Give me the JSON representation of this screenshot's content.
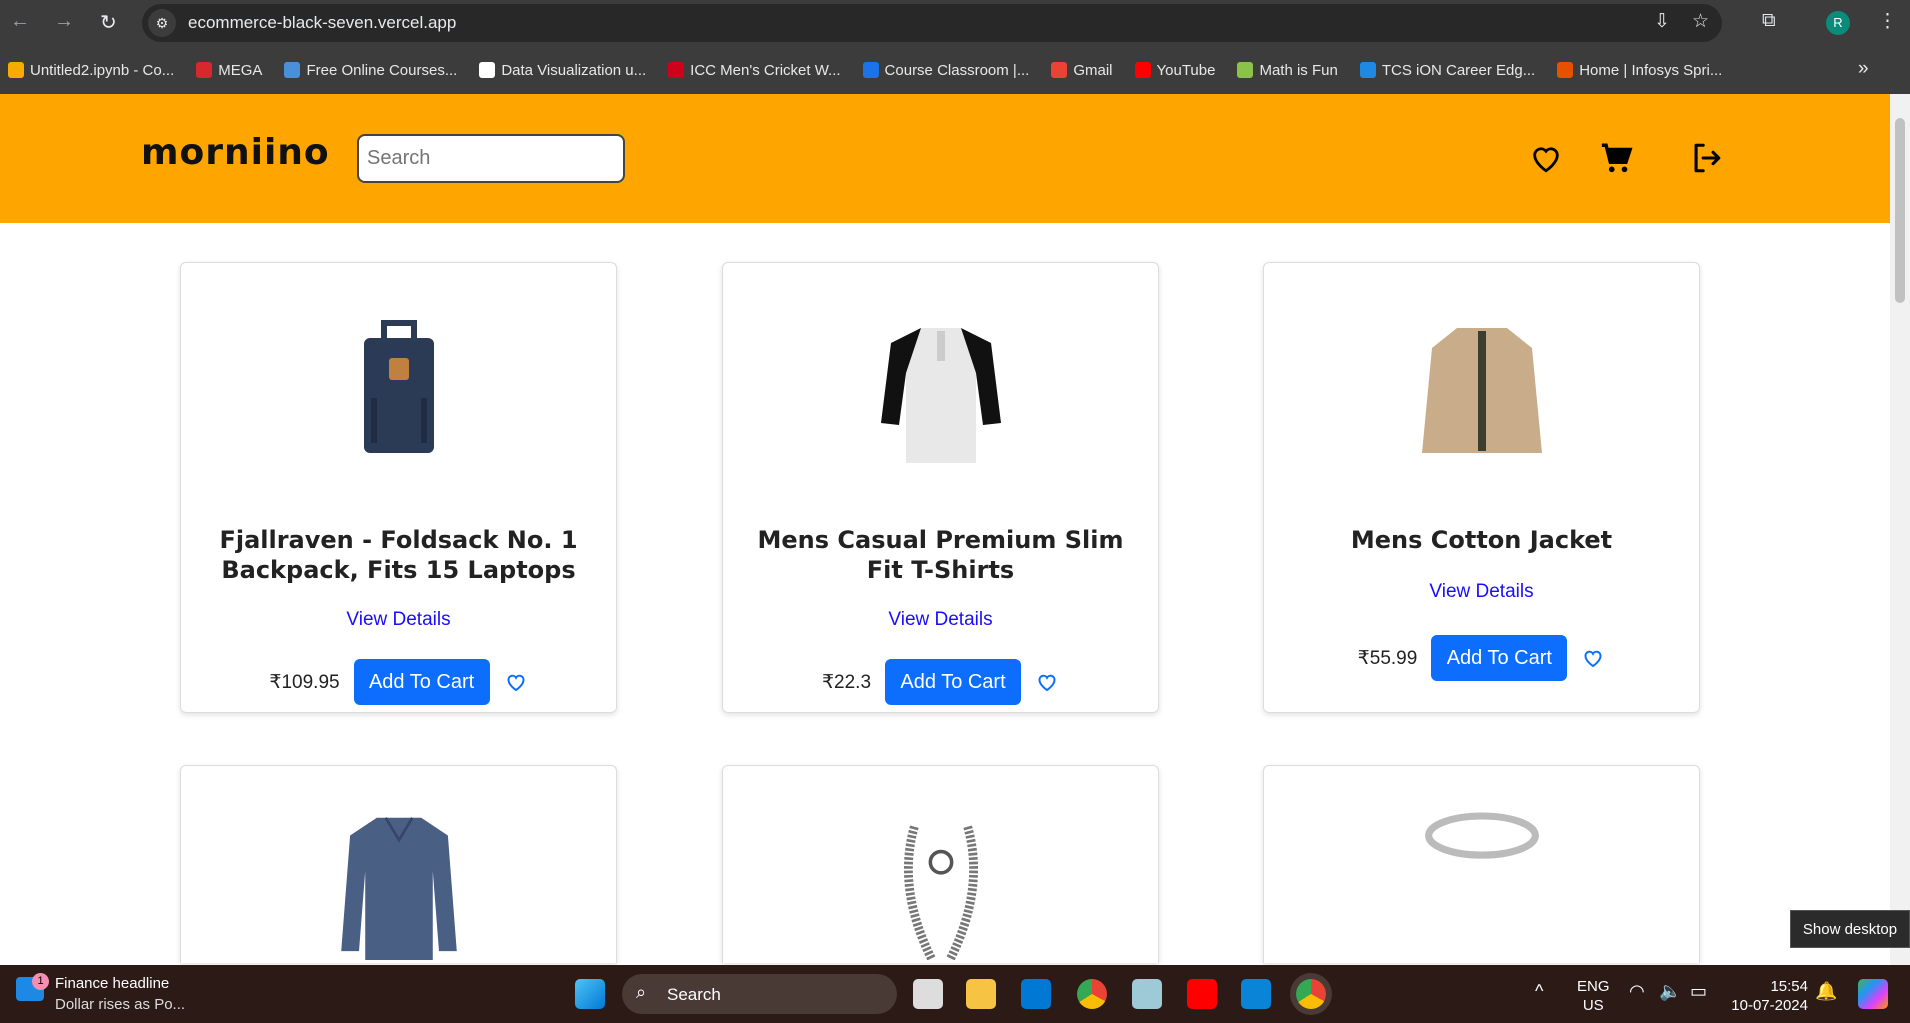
{
  "browser": {
    "url": "ecommerce-black-seven.vercel.app",
    "profile_initial": "R",
    "bookmarks": [
      {
        "label": "Untitled2.ipynb - Co...",
        "color": "#f9ab00"
      },
      {
        "label": "MEGA",
        "color": "#d9272e"
      },
      {
        "label": "Free Online Courses...",
        "color": "#4a90d9"
      },
      {
        "label": "Data Visualization u...",
        "color": "#ffffff"
      },
      {
        "label": "ICC Men's Cricket W...",
        "color": "#d0021b"
      },
      {
        "label": "Course Classroom |...",
        "color": "#1a73e8"
      },
      {
        "label": "Gmail",
        "color": "#ea4335"
      },
      {
        "label": "YouTube",
        "color": "#ff0000"
      },
      {
        "label": "Math is Fun",
        "color": "#8bc34a"
      },
      {
        "label": "TCS iON Career Edg...",
        "color": "#1e88e5"
      },
      {
        "label": "Home | Infosys Spri...",
        "color": "#e65100"
      }
    ],
    "more": "»"
  },
  "header": {
    "logo": "morniino",
    "search_placeholder": "Search",
    "accent": "#ffa500"
  },
  "products": [
    {
      "title": "Fjallraven - Foldsack No. 1 Backpack, Fits 15 Laptops",
      "view": "View Details",
      "price": "₹109.95",
      "cta": "Add To Cart",
      "kind": "backpack"
    },
    {
      "title": "Mens Casual Premium Slim Fit T-Shirts",
      "view": "View Details",
      "price": "₹22.3",
      "cta": "Add To Cart",
      "kind": "tshirt"
    },
    {
      "title": "Mens Cotton Jacket",
      "view": "View Details",
      "price": "₹55.99",
      "cta": "Add To Cart",
      "kind": "jacket"
    },
    {
      "kind": "sweater"
    },
    {
      "kind": "bracelet"
    },
    {
      "kind": "ring"
    }
  ],
  "taskbar": {
    "news_title": "Finance headline",
    "news_sub": "Dollar rises as Po...",
    "news_badge": "1",
    "search": "Search",
    "lang1": "ENG",
    "lang2": "US",
    "time": "15:54",
    "date": "10-07-2024",
    "tooltip": "Show desktop"
  }
}
